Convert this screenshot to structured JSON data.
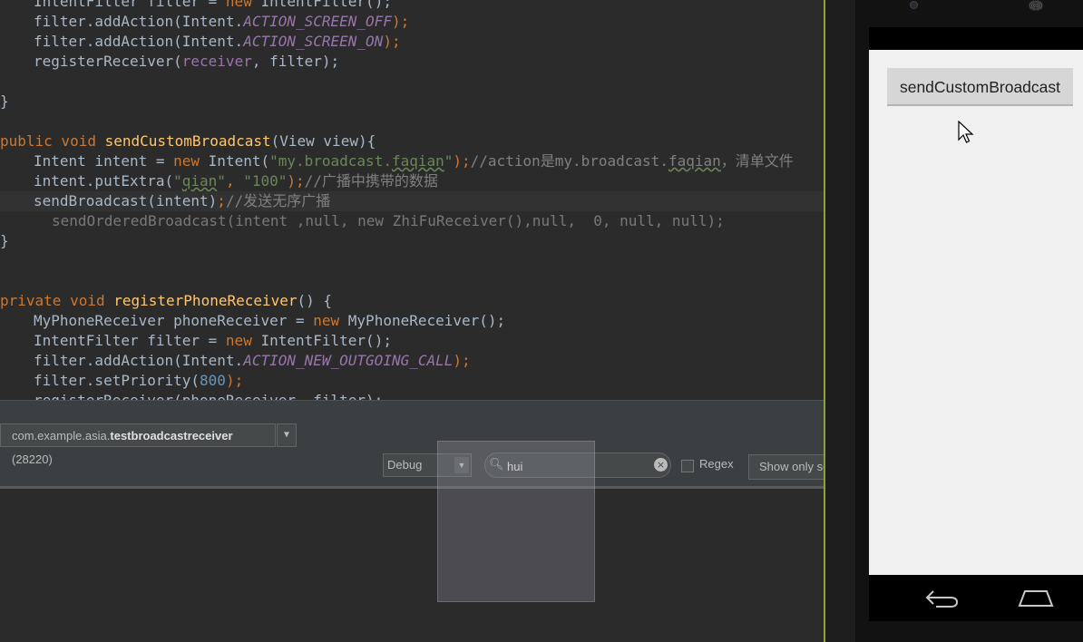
{
  "editor": {
    "lines": [
      [
        [
          "IntentFilter filter = ",
          "p"
        ],
        [
          "new",
          "k"
        ],
        [
          " IntentFilter();",
          "p"
        ]
      ],
      [
        [
          "filter.addAction(Intent.",
          "p"
        ],
        [
          "ACTION_SCREEN_OFF",
          "f"
        ],
        [
          ");",
          "k"
        ]
      ],
      [
        [
          "filter.addAction(Intent.",
          "p"
        ],
        [
          "ACTION_SCREEN_ON",
          "f"
        ],
        [
          ");",
          "k"
        ]
      ],
      [
        [
          "registerReceiver(",
          "p"
        ],
        [
          "receiver",
          "v"
        ],
        [
          ", filter);",
          "p"
        ]
      ],
      [],
      [
        [
          "}",
          "p"
        ]
      ],
      [],
      [
        [
          "public void ",
          "k"
        ],
        [
          "sendCustomBroadcast",
          "m"
        ],
        [
          "(View view){",
          "p"
        ]
      ],
      [
        [
          "Intent intent = ",
          "p"
        ],
        [
          "new",
          "k"
        ],
        [
          " Intent(",
          "p"
        ],
        [
          "\"my.broadcast.",
          "s"
        ],
        [
          "faqian",
          "su"
        ],
        [
          "\"",
          "s"
        ],
        [
          ");",
          "k"
        ],
        [
          "//action是my.broadcast.",
          "c"
        ],
        [
          "faqian",
          "cu"
        ],
        [
          "，清单文件",
          "c"
        ]
      ],
      [
        [
          "intent.putExtra(",
          "p"
        ],
        [
          "\"",
          "s"
        ],
        [
          "qian",
          "su"
        ],
        [
          "\"",
          "s"
        ],
        [
          ", ",
          "k"
        ],
        [
          "\"100\"",
          "s"
        ],
        [
          ");",
          "k"
        ],
        [
          "//广播中携带的数据",
          "c"
        ]
      ],
      [
        [
          "sendBroadcast(intent)",
          "p"
        ],
        [
          ";",
          "k"
        ],
        [
          "//发送无序广播",
          "c"
        ]
      ],
      [
        [
          "sendOrderedBroadcast(intent ,null, new ZhiFuReceiver(),null,  0, null, null);",
          "ghost"
        ]
      ],
      [
        [
          "}",
          "p"
        ]
      ],
      [],
      [],
      [
        [
          "private void ",
          "k"
        ],
        [
          "registerPhoneReceiver",
          "m"
        ],
        [
          "() {",
          "p"
        ]
      ],
      [
        [
          "MyPhoneReceiver phoneReceiver = ",
          "p"
        ],
        [
          "new",
          "k"
        ],
        [
          " MyPhoneReceiver();",
          "p"
        ]
      ],
      [
        [
          "IntentFilter filter = ",
          "p"
        ],
        [
          "new",
          "k"
        ],
        [
          " IntentFilter();",
          "p"
        ]
      ],
      [
        [
          "filter.addAction(Intent.",
          "p"
        ],
        [
          "ACTION_NEW_OUTGOING_CALL",
          "f"
        ],
        [
          ");",
          "k"
        ]
      ],
      [
        [
          "filter.setPriority(",
          "p"
        ],
        [
          "800",
          "n"
        ],
        [
          ");",
          "k"
        ]
      ],
      [
        [
          "registerReceiver(phoneReceiver, filter);",
          "p"
        ]
      ]
    ]
  },
  "logcat": {
    "process_package": "com.example.asia.",
    "process_name": "testbroadcastreceiver",
    "process_pid": "(28220)",
    "level": "Debug",
    "search_value": "hui",
    "regex_label": "Regex",
    "filter_label": "Show only selected application"
  },
  "device": {
    "button_label": "sendCustomBroadcast"
  },
  "colors": {
    "keyword": "#cc7832",
    "method": "#ffc66d",
    "string": "#6a8759",
    "field": "#9876aa",
    "comment": "#808080",
    "number": "#6897bb",
    "editor_bg": "#2b2b2b",
    "app_bg": "#f0f0f0"
  },
  "icons": [
    "search-icon",
    "clear-icon",
    "dropdown-arrow-icon",
    "back-icon",
    "home-icon",
    "mouse-cursor-icon"
  ]
}
